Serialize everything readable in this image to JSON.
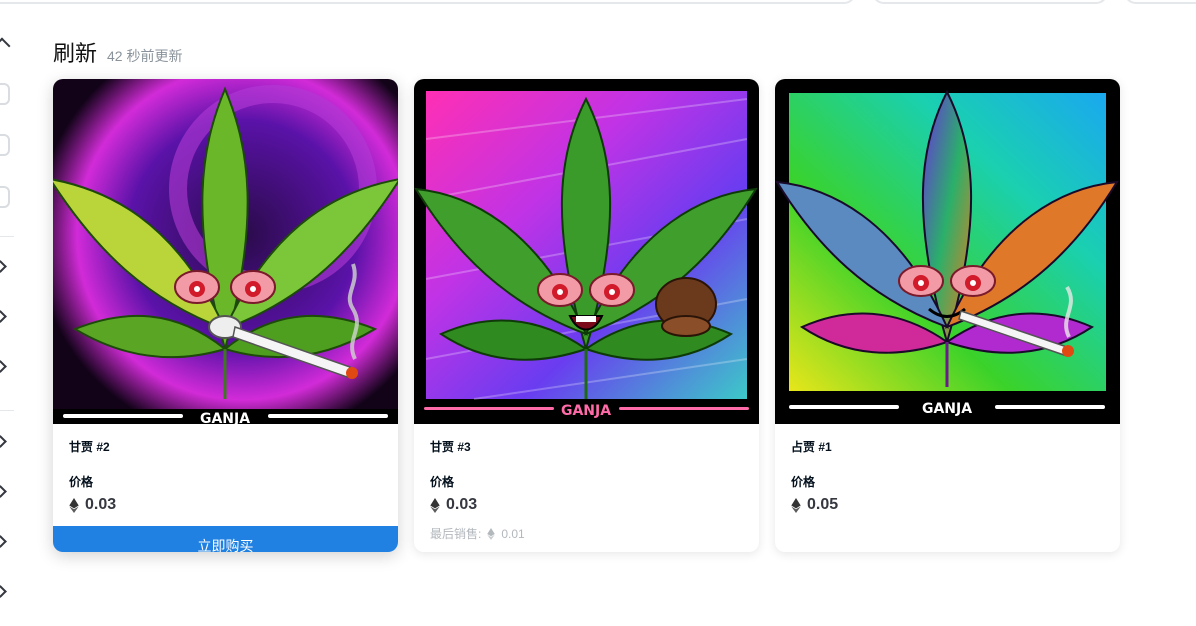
{
  "heading": {
    "title": "刷新",
    "updated": "42 秒前更新"
  },
  "cards": [
    {
      "name": "甘贾 #2",
      "price_label": "价格",
      "price": "0.03",
      "buy_label": "立即购买"
    },
    {
      "name": "甘贾 #3",
      "price_label": "价格",
      "price": "0.03",
      "last_sale_label": "最后销售:",
      "last_sale": "0.01"
    },
    {
      "name": "占贾 #1",
      "price_label": "价格",
      "price": "0.05"
    }
  ],
  "art_text": "GANJA",
  "icons": [
    "chevron-up-icon",
    "checkbox-icon",
    "chevron-down-icon",
    "eth-icon"
  ],
  "colors": {
    "buy_button": "#2081e2",
    "text_primary": "#04111d",
    "text_muted": "#8a939b"
  }
}
